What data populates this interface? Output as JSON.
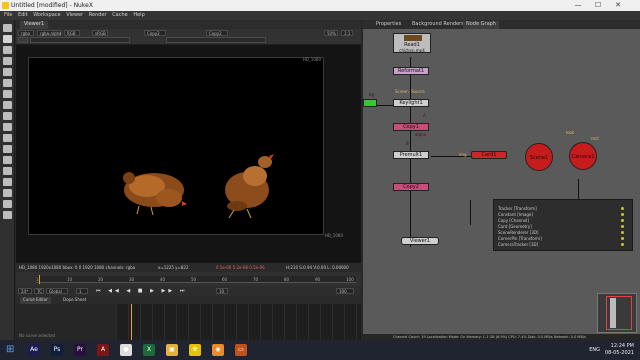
{
  "window": {
    "title": "Untitled [modified] - NukeX",
    "minimize": "—",
    "maximize": "☐",
    "close": "✕"
  },
  "menu": [
    "File",
    "Edit",
    "Workspace",
    "Viewer",
    "Render",
    "Cache",
    "Help"
  ],
  "viewer": {
    "tab": "Viewer1",
    "channels": "rgba",
    "alpha": "rgba.alpha",
    "colorspace": "RGB",
    "frame": "sRGB",
    "input_a": "Copy2",
    "input_b": "Copy2",
    "zoom": "50%",
    "ratio": "1:1",
    "format_label": "HD_1080",
    "status": "HD_1080 1920x1080  bbox: 0 0 1920 1080 channels: rgba",
    "coords": "x=1225 y=822",
    "values": "0.5e-06  5.2e-06  0.5e-06",
    "hsv": "H:210 S:0.94 V:0.00  L: 0.00000"
  },
  "timeline": {
    "ticks": [
      "1",
      "10",
      "20",
      "30",
      "40",
      "50",
      "60",
      "70",
      "80",
      "90",
      "100"
    ],
    "fps": "24*",
    "mode": "TC",
    "global": "Global",
    "current_frame": "1",
    "step": "10",
    "end": "100"
  },
  "curve_tabs": [
    "Curve Editor",
    "Dope Sheet"
  ],
  "curve_status": "No curve selected",
  "right_tabs": [
    "Properties",
    "Background Renders",
    "Node Graph"
  ],
  "nodes": {
    "read": "Read1",
    "read_sub": "chicken.mp4",
    "reformat": "Reformat1",
    "keylight": "Keylight1",
    "copy1": "Copy1",
    "premult": "Premult1",
    "copy2": "Copy2",
    "card": "Card1",
    "viewer": "Viewer1",
    "scene": "Scene1",
    "camera": "Camera1",
    "label_bg": "bg",
    "label_screen": "Screen",
    "label_source": "Source",
    "label_img": "img",
    "label_look": "look",
    "label_rect": "rect",
    "label_a": "A",
    "label_b": "B",
    "label_alpha": "alpha"
  },
  "pipeline": [
    {
      "name": "Tracker [Transform]"
    },
    {
      "name": "Constant [Image]"
    },
    {
      "name": "Copy [Channel]"
    },
    {
      "name": "Card [Geometry]"
    },
    {
      "name": "SceneRenderer [3D]"
    },
    {
      "name": "CornerPin [Transform]"
    },
    {
      "name": "CameraTracker [3D]"
    }
  ],
  "graph_status": "Channel Count: 19  Localization Mode: On  Memory: 1.1 GB (6.9%)  CPU: 7.4%  Disk: 0.0 MB/s  Network: 0.0 MB/s",
  "taskbar": {
    "apps": [
      {
        "name": "ae-icon",
        "color": "#1d1b4f",
        "glyph": "Ae"
      },
      {
        "name": "ps-icon",
        "color": "#0e1e3b",
        "glyph": "Ps"
      },
      {
        "name": "pr-icon",
        "color": "#2a0e3b",
        "glyph": "Pr"
      },
      {
        "name": "acrobat-icon",
        "color": "#7a1616",
        "glyph": "A"
      },
      {
        "name": "chrome-icon",
        "color": "#dddddd",
        "glyph": "●"
      },
      {
        "name": "excel-icon",
        "color": "#1d6b3a",
        "glyph": "X"
      },
      {
        "name": "files-icon",
        "color": "#e2b23c",
        "glyph": "▣"
      },
      {
        "name": "nuke-icon",
        "color": "#e6c300",
        "glyph": "☢"
      },
      {
        "name": "blender-icon",
        "color": "#e98a2b",
        "glyph": "◉"
      },
      {
        "name": "app-icon",
        "color": "#c1521b",
        "glyph": "▭"
      }
    ],
    "language": "ENG",
    "time": "12:24 PM",
    "date": "08-05-2021"
  }
}
